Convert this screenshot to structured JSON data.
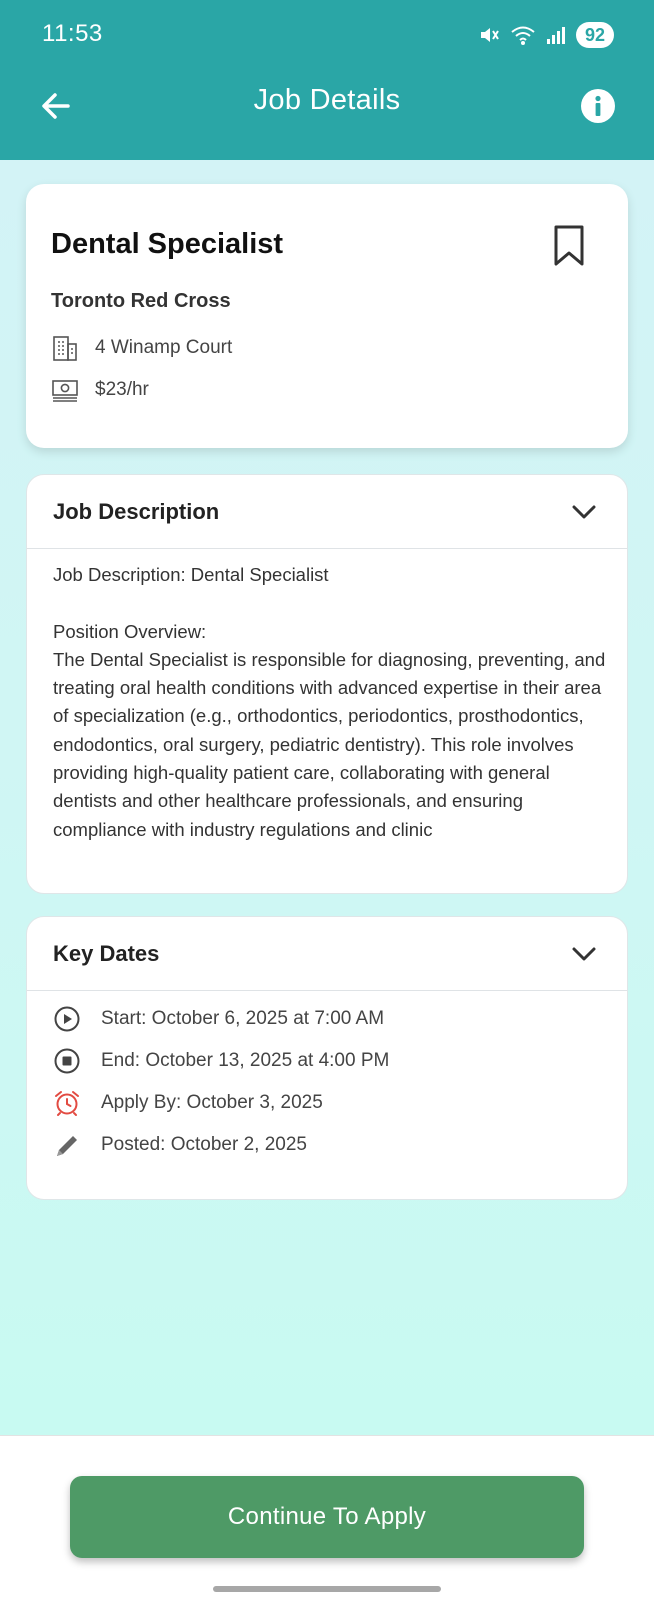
{
  "status_bar": {
    "time": "11:53",
    "battery": "92",
    "icons": [
      "mute-icon",
      "wifi-icon",
      "signal-icon"
    ]
  },
  "app_bar": {
    "title": "Job Details",
    "back_icon": "arrow-back-icon",
    "info_icon": "info-icon"
  },
  "job": {
    "title": "Dental Specialist",
    "organization": "Toronto Red Cross",
    "address": "4 Winamp Court",
    "pay": "$23/hr",
    "bookmark_icon": "bookmark-icon"
  },
  "description": {
    "header": "Job Description",
    "first_line": "Job Description: Dental Specialist",
    "overview_label": "Position Overview:",
    "overview_text": "The Dental Specialist is responsible for diagnosing, preventing, and treating oral health conditions with advanced expertise in their area of specialization (e.g., orthodontics, periodontics, prosthodontics, endodontics, oral surgery, pediatric dentistry). This role involves providing high-quality patient care, collaborating with general dentists and other healthcare professionals, and ensuring compliance with industry regulations and clinic"
  },
  "key_dates": {
    "header": "Key Dates",
    "start": "Start: October 6, 2025 at 7:00 AM",
    "end": "End: October 13, 2025 at 4:00 PM",
    "apply_by": "Apply By: October 3, 2025",
    "posted": "Posted: October 2, 2025"
  },
  "footer": {
    "apply_button": "Continue To Apply"
  },
  "colors": {
    "header": "#2aa6a6",
    "apply_button": "#4e9a66",
    "alarm_icon": "#e24b42"
  }
}
